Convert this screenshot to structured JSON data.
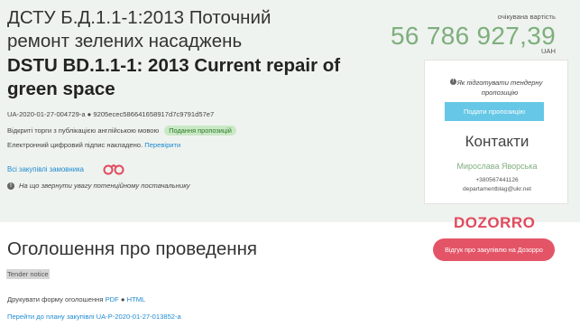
{
  "title_ua": "ДСТУ Б.Д.1.1-1:2013 Поточний ремонт зелених насаджень",
  "title_en": "DSTU BD.1.1-1: 2013 Current repair of green space",
  "tender_id": "UA-2020-01-27-004729-a",
  "tender_hash": "9205ecec586641658917d7c9791d57e7",
  "procedure_type": "Відкриті торги з публікацією англійською мовою",
  "status_badge": "Подання пропозицій",
  "signature_text": "Електронний цифровий підпис накладено.",
  "verify_link": "Перевірити",
  "buyer_purchases_link": "Всі закупівлі замовника",
  "warning_text": "На що звернути увагу потенційному постачальнику",
  "price": {
    "label": "очікувана вартість",
    "value": "56 786 927,39",
    "currency": "UAH"
  },
  "side_card": {
    "howto_text": "Як підготувати тендерну пропозицію",
    "submit_button": "Подати пропозицію",
    "contacts_title": "Контакти",
    "contact_name": "Мирослава Яворська",
    "contact_phone": "+380567441126",
    "contact_email": "departamentblag@ukr.net"
  },
  "dozorro": {
    "logo": "DOZORRO",
    "button": "Відгук про закупівлю на Дозорро"
  },
  "announcement": {
    "title": "Оголошення про проведення",
    "tender_notice": "Tender notice",
    "print_label": "Друкувати форму оголошення",
    "pdf": "PDF",
    "html": "HTML",
    "plan_link": "Перейти до плану закупівлі UA-P-2020-01-27-013852-a"
  },
  "colors": {
    "band": "#eef3ef",
    "price": "#7fae7d",
    "link": "#1f8ad1",
    "submit": "#66c7e6",
    "dozorro": "#e24a5e",
    "badge_bg": "#c9e9c5",
    "badge_text": "#2f7a2b"
  },
  "icons": [
    "binoculars-icon",
    "info-icon"
  ]
}
